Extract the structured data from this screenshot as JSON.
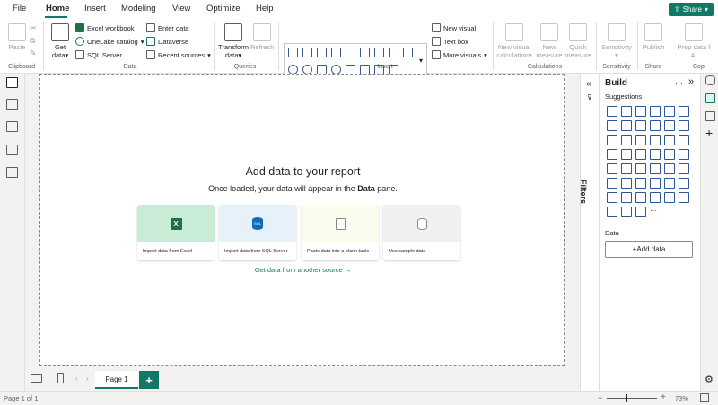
{
  "menu": {
    "file": "File",
    "home": "Home",
    "insert": "Insert",
    "modeling": "Modeling",
    "view": "View",
    "optimize": "Optimize",
    "help": "Help"
  },
  "share": "Share",
  "ribbon": {
    "clipboard": {
      "paste": "Paste",
      "label": "Clipboard"
    },
    "data": {
      "get_data_line1": "Get",
      "get_data_line2": "data",
      "excel": "Excel workbook",
      "onelake": "OneLake catalog",
      "sql": "SQL Server",
      "enter_data": "Enter data",
      "dataverse": "Dataverse",
      "recent": "Recent sources",
      "label": "Data"
    },
    "queries": {
      "transform_line1": "Transform",
      "transform_line2": "data",
      "refresh": "Refresh",
      "label": "Queries"
    },
    "insert": {
      "new_visual": "New visual",
      "text_box": "Text box",
      "more_visuals": "More visuals",
      "label": "Insert"
    },
    "calculations": {
      "new_visual_calc_line1": "New visual",
      "new_visual_calc_line2": "calculation",
      "new_measure_line1": "New",
      "new_measure_line2": "measure",
      "quick_measure_line1": "Quick",
      "quick_measure_line2": "measure",
      "label": "Calculations"
    },
    "sensitivity": {
      "button": "Sensitivity",
      "label": "Sensitivity"
    },
    "share": {
      "publish": "Publish",
      "label": "Share"
    },
    "copilot": {
      "prep_line1": "Prep data f",
      "prep_line2": "AI",
      "label": "Cop"
    }
  },
  "canvas": {
    "title": "Add data to your report",
    "subtitle_before": "Once loaded, your data will appear in the ",
    "subtitle_bold": "Data",
    "subtitle_after": " pane.",
    "cards": [
      {
        "label": "Import data from Excel",
        "bg": "#c8ecd5",
        "icon": "X"
      },
      {
        "label": "Import data from SQL Server",
        "bg": "#e6f1fa",
        "icon": "SQL"
      },
      {
        "label": "Paste data into a blank table",
        "bg": "#fbfbee",
        "icon": ""
      },
      {
        "label": "Use sample data",
        "bg": "#f0f0f0",
        "icon": ""
      }
    ],
    "other_source": "Get data from another source →"
  },
  "filters": {
    "label": "Filters"
  },
  "build": {
    "title": "Build",
    "suggestions": "Suggestions",
    "data_label": "Data",
    "add_data": "+Add data"
  },
  "tabs": {
    "page1": "Page 1",
    "add": "+"
  },
  "status": {
    "page_of": "Page 1 of 1",
    "zoom": "73%",
    "zoom_fraction": 0.4
  },
  "colors": {
    "accent": "#117865",
    "excel": "#1e7145",
    "sql": "#0f6cbd"
  }
}
